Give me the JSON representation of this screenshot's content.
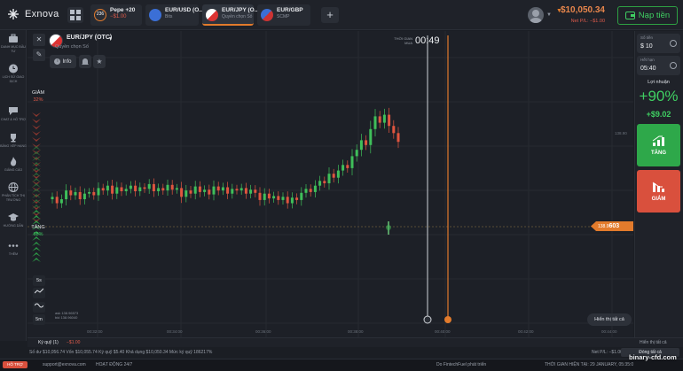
{
  "app": {
    "logo": "Exnova"
  },
  "tabs": [
    {
      "name": "Pepe +20",
      "sub": "−$1.00",
      "sub_class": "red",
      "badge": "236",
      "icon_color": "#e27b2c"
    },
    {
      "name": "EUR/USD (O...",
      "sub": "Bits",
      "icon_color": "#3b6fd6"
    },
    {
      "name": "EUR/JPY (O...",
      "sub": "Quyền chọn Số",
      "icon_color": "#d33a3a"
    },
    {
      "name": "EUR/GBP",
      "sub": "SCMP",
      "icon_color": "#3b6fd6"
    }
  ],
  "header": {
    "balance": "$10,050.34",
    "net_pl": "Net P/L: −$1.00",
    "deposit_label": "Nạp tiền"
  },
  "sidebar": {
    "items": [
      {
        "label": "DANH MỤC ĐẦU TƯ",
        "icon": "briefcase-icon"
      },
      {
        "label": "LỊCH SỬ GIAO DỊCH",
        "icon": "clock-icon"
      },
      {
        "label": "CHAT & HỖ TRỢ",
        "icon": "chat-icon"
      },
      {
        "label": "BẢNG XẾP HẠNG",
        "icon": "trophy-icon"
      },
      {
        "label": "GIẢNG CẢO",
        "icon": "flame-icon"
      },
      {
        "label": "PHÂN TÍCH THỊ TRƯỜNG",
        "icon": "globe-icon"
      },
      {
        "label": "HƯỚNG DẪN",
        "icon": "graduation-cap-icon"
      },
      {
        "label": "THÊM",
        "icon": "more-icon"
      }
    ]
  },
  "asset": {
    "name": "EUR/JPY (OTC)",
    "type": "Quyền chọn Số"
  },
  "toolbar": {
    "info_label": "Info"
  },
  "timer": {
    "label": "THỜI GIAN MUA",
    "value": "00:49"
  },
  "sentiment": {
    "down_label": "GIẢM",
    "down_pct": "32%",
    "up_label": "TĂNG",
    "up_pct": "68%"
  },
  "price": {
    "prefix": "138.9",
    "suffix": "603",
    "axis_label": "138.90"
  },
  "time_axis": [
    "00:32:00",
    "00:34:00",
    "00:36:00",
    "00:38:00",
    "00:40:00",
    "00:42:00",
    "00:44:00"
  ],
  "timeframes": [
    "5s",
    "2m",
    "5m"
  ],
  "mini_stats": [
    "ask 138.96573",
    "bid 138.96040"
  ],
  "show_all_label": "Hiển thị tất cả",
  "right_panel": {
    "amount_label": "Số tiền",
    "amount_value": "$ 10",
    "expiry_label": "Hết hạn",
    "expiry_value": "05:40",
    "profit_label": "Lợi nhuận",
    "profit_pct": "+90%",
    "profit_amt": "+$9.02",
    "up_label": "TĂNG",
    "down_label": "GIẢM"
  },
  "bottom": {
    "fund_label": "Ký quỹ (1)",
    "fund_pl": "−$1.00",
    "balance_line": "Số dư $10,056.74   Vốn $10,055.74   Ký quỹ $5.40   Khả dụng $10,050.34   Mức ký quỹ 186217%",
    "net_pl": "Net P/L: −$1.00",
    "show_menu": "Hiển thị tất cả",
    "close_all": "Đóng tất cả"
  },
  "status": {
    "live": "HỖ TRỢ",
    "email": "support@exnova.com",
    "hours": "HOẠT ĐỘNG 24/7",
    "sponsor": "Do  FintechFuel phát triển",
    "time": "THỜI GIAN HIỆN TẠI:  29 JANUARY, 05:35:0"
  },
  "watermark": "binary-cfd.com",
  "colors": {
    "accent": "#e27b2c",
    "up": "#3fcf62",
    "down": "#e05b4b"
  },
  "chart_data": {
    "type": "candlestick",
    "candles": [
      [
        0,
        1,
        1
      ],
      [
        1,
        0,
        1
      ],
      [
        2,
        1,
        1
      ],
      [
        3,
        1,
        2
      ],
      [
        4,
        0,
        1
      ],
      [
        5,
        1,
        2
      ],
      [
        6,
        0,
        1
      ],
      [
        7,
        1,
        1
      ],
      [
        8,
        0,
        2
      ],
      [
        9,
        1,
        1
      ],
      [
        10,
        1,
        1
      ],
      [
        11,
        0,
        1
      ],
      [
        12,
        1,
        1
      ],
      [
        13,
        0,
        1
      ],
      [
        14,
        1,
        2
      ],
      [
        15,
        0,
        1
      ],
      [
        16,
        1,
        1
      ],
      [
        17,
        0,
        1
      ],
      [
        18,
        1,
        1
      ],
      [
        19,
        0,
        2
      ],
      [
        20,
        1,
        1
      ],
      [
        21,
        0,
        1
      ],
      [
        22,
        1,
        1
      ],
      [
        23,
        0,
        1
      ],
      [
        24,
        1,
        2
      ],
      [
        25,
        0,
        1
      ],
      [
        26,
        1,
        1
      ],
      [
        27,
        0,
        1
      ],
      [
        28,
        1,
        1
      ],
      [
        29,
        0,
        1
      ],
      [
        30,
        0,
        2
      ],
      [
        31,
        1,
        1
      ],
      [
        32,
        0,
        1
      ],
      [
        33,
        1,
        1
      ],
      [
        34,
        1,
        2
      ],
      [
        35,
        0,
        1
      ],
      [
        36,
        1,
        1
      ],
      [
        37,
        0,
        1
      ],
      [
        38,
        1,
        2
      ],
      [
        39,
        0,
        1
      ],
      [
        40,
        1,
        1
      ],
      [
        41,
        0,
        1
      ],
      [
        42,
        1,
        1
      ],
      [
        43,
        0,
        1
      ],
      [
        44,
        1,
        2
      ],
      [
        45,
        0,
        1
      ],
      [
        46,
        1,
        1
      ],
      [
        47,
        0,
        2
      ],
      [
        48,
        1,
        1
      ],
      [
        49,
        0,
        1
      ],
      [
        50,
        1,
        1
      ],
      [
        51,
        0,
        1
      ],
      [
        52,
        1,
        1
      ],
      [
        53,
        1,
        2
      ],
      [
        54,
        0,
        1
      ],
      [
        55,
        1,
        1
      ],
      [
        56,
        0,
        1
      ],
      [
        57,
        1,
        2
      ],
      [
        58,
        0,
        1
      ],
      [
        59,
        1,
        1
      ],
      [
        60,
        0,
        1
      ],
      [
        61,
        1,
        1
      ],
      [
        62,
        1,
        2
      ],
      [
        63,
        1,
        1
      ],
      [
        64,
        0,
        1
      ],
      [
        65,
        1,
        1
      ],
      [
        66,
        0,
        1
      ],
      [
        67,
        1,
        2
      ],
      [
        68,
        1,
        1
      ],
      [
        69,
        0,
        1
      ],
      [
        70,
        1,
        1
      ],
      [
        71,
        1,
        2
      ],
      [
        72,
        0,
        1
      ],
      [
        73,
        1,
        1
      ],
      [
        74,
        0,
        1
      ],
      [
        75,
        1,
        1
      ]
    ]
  }
}
